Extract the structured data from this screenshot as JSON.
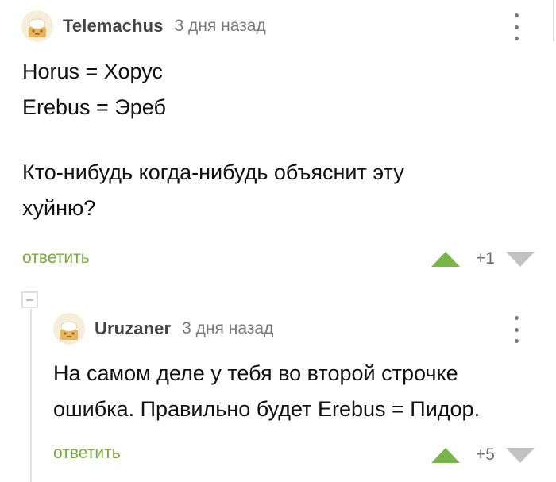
{
  "comments": [
    {
      "author": "Telemachus",
      "time": "3 дня назад",
      "lines": [
        "Horus = Хорус",
        "Erebus = Эреб",
        "",
        "Кто-нибудь когда-нибудь объяснит эту",
        "хуйню?"
      ],
      "reply_label": "ответить",
      "rating": "+1",
      "avatar_icon": "default-avatar-icon"
    },
    {
      "author": "Uruzaner",
      "time": "3 дня назад",
      "lines": [
        "На самом деле у тебя во второй строчке",
        "ошибка. Правильно будет Erebus = Пидор."
      ],
      "reply_label": "ответить",
      "rating": "+5",
      "avatar_icon": "default-avatar-icon"
    }
  ],
  "colors": {
    "accent_green": "#79b64a",
    "reply_green": "#7aa942",
    "vote_down_gray": "#c2c2c2",
    "meta_gray": "#7a7a7a"
  },
  "icons": {
    "collapse": "collapse-minus-icon",
    "menu": "kebab-menu-icon",
    "upvote": "upvote-arrow-icon",
    "downvote": "downvote-arrow-icon"
  }
}
